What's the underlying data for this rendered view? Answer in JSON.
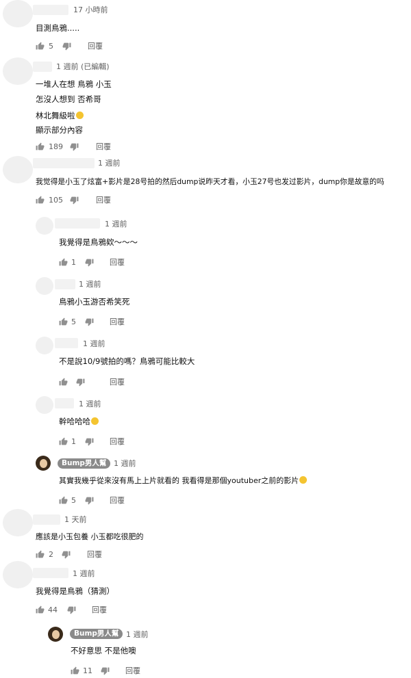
{
  "icons": {
    "like": "thumb-up-icon",
    "dislike": "thumb-down-icon",
    "emoji": "emoji-icon"
  },
  "comments": [
    {
      "time": "17 小時前",
      "lines": [
        "目測鳥鴉....."
      ],
      "likes": "5",
      "reply": "回覆"
    },
    {
      "time": "1 週前 (已編輯)",
      "lines": [
        "一堆人在想 鳥鴉 小玉",
        "怎沒人想到 否希哥",
        "林北舞級啦",
        "顯示部分內容"
      ],
      "likes": "189",
      "reply": "回覆"
    },
    {
      "time": "1 週前",
      "lines": [
        "我觉得是小玉了炫富+影片是28号拍的然后dump说昨天才看，小玉27号也发过影片，dump你是故意的吗"
      ],
      "likes": "105",
      "reply": "回覆"
    },
    {
      "time": "1 週前",
      "lines": [
        "我覺得是鳥鴉欸～～～"
      ],
      "likes": "1",
      "reply": "回覆"
    },
    {
      "time": "1 週前",
      "lines": [
        "鳥鴉小玉游否希笑死"
      ],
      "likes": "5",
      "reply": "回覆"
    },
    {
      "time": "1 週前",
      "lines": [
        "不是說10/9號拍的嗎？鳥鴉可能比較大"
      ],
      "likes": "",
      "reply": "回覆"
    },
    {
      "time": "1 週前",
      "lines": [
        "幹哈哈哈"
      ],
      "likes": "1",
      "reply": "回覆"
    },
    {
      "author": "Bump男人幫",
      "time": "1 週前",
      "lines": [
        "其實我幾乎從來沒有馬上上片就看的 我看得是那個youtuber之前的影片"
      ],
      "likes": "5",
      "reply": "回覆"
    },
    {
      "time": "1 天前",
      "lines": [
        "應該是小玉包養 小玉都吃很肥的"
      ],
      "likes": "2",
      "reply": "回覆"
    },
    {
      "time": "1 週前",
      "lines": [
        "我覺得是鳥鴉（猜測）"
      ],
      "likes": "44",
      "reply": "回覆"
    },
    {
      "author": "Bump男人幫",
      "time": "1 週前",
      "lines": [
        "不好意思 不是他噢"
      ],
      "likes": "11",
      "reply": "回覆"
    }
  ]
}
